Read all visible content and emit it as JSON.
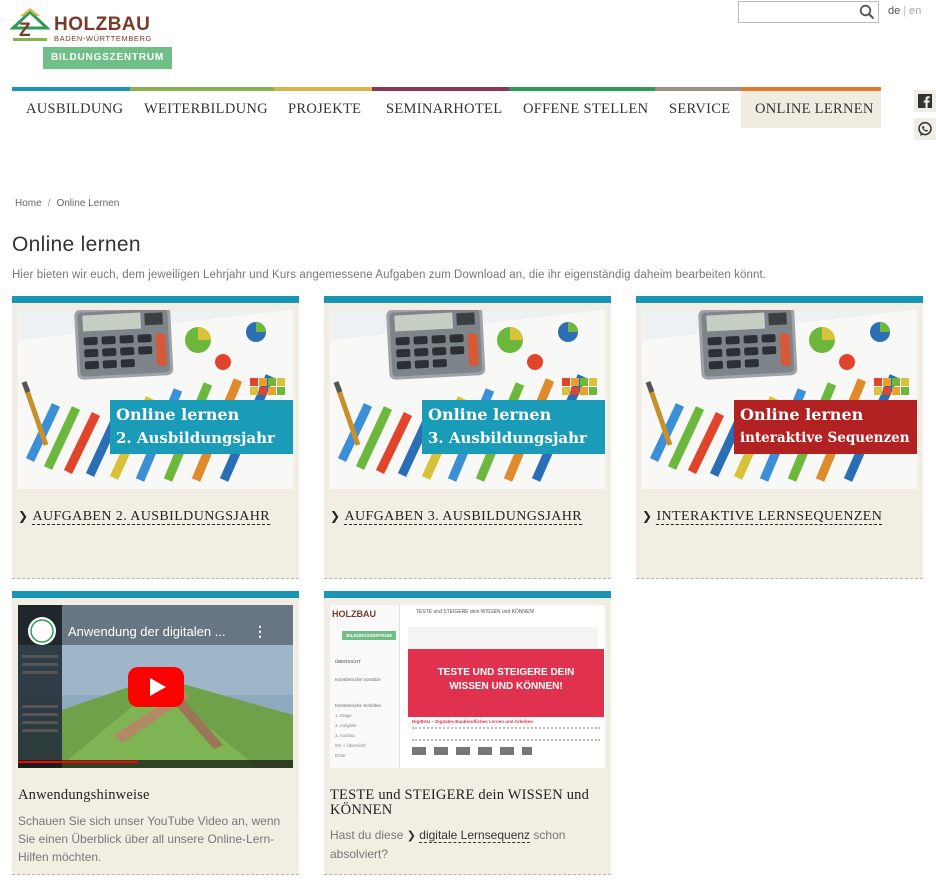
{
  "header": {
    "brand": "HOLZBAU",
    "brand_sub": "BADEN-WÜRTTEMBERG",
    "brand_badge": "BILDUNGSZENTRUM",
    "search_placeholder": "",
    "lang_de": "de",
    "lang_sep": "|",
    "lang_en": "en"
  },
  "nav": {
    "items": [
      {
        "label": "AUSBILDUNG",
        "color": "#1896b4"
      },
      {
        "label": "WEITERBILDUNG",
        "color": "#8bb24a"
      },
      {
        "label": "PROJEKTE",
        "color": "#d9b54a"
      },
      {
        "label": "SEMINARHOTEL",
        "color": "#8e3554"
      },
      {
        "label": "OFFENE STELLEN",
        "color": "#2f9a57"
      },
      {
        "label": "SERVICE",
        "color": "#9b9081"
      },
      {
        "label": "ONLINE LERNEN",
        "color": "#e07b2c"
      }
    ]
  },
  "breadcrumb": {
    "home": "Home",
    "sep": "/",
    "current": "Online Lernen"
  },
  "page": {
    "title": "Online lernen",
    "intro": "Hier bieten wir euch, dem jeweiligen Lehrjahr und Kurs angemessene Aufgaben zum Download an, die ihr eigenständig daheim bearbeiten könnt."
  },
  "cards": [
    {
      "overlay_line1": "Online lernen",
      "overlay_line2": "2. Ausbildungsjahr",
      "overlay_color": "#1a9bb8",
      "link": "AUFGABEN 2. AUSBILDUNGSJAHR"
    },
    {
      "overlay_line1": "Online lernen",
      "overlay_line2": "3. Ausbildungsjahr",
      "overlay_color": "#1a9bb8",
      "link": "AUFGABEN 3. AUSBILDUNGSJAHR"
    },
    {
      "overlay_line1": "Online lernen",
      "overlay_line2": "interaktive Sequenzen",
      "overlay_color": "#b22222",
      "link": "INTERAKTIVE LERNSEQUENZEN"
    },
    {
      "video_title": "Anwendung der digitalen ...",
      "title": "Anwendungshinweise",
      "text": "Schauen Sie sich unser YouTube Video an, wenn Sie einen Überblick über all unsere Online-Lern-Hilfen möchten."
    },
    {
      "title": "TESTE und STEIGERE dein WISSEN und KÖNNEN",
      "text_before": "Hast du diese",
      "link": "digitale Lernsequenz",
      "text_after": "schon absolviert?",
      "thumb_brand": "HOLZBAU",
      "thumb_badge": "BILDUNGSZENTRUM",
      "thumb_heading": "TESTE und STEIGERE dein WISSEN und KÖNNEN!",
      "thumb_banner_line1": "TESTE UND STEIGERE DEIN",
      "thumb_banner_line2": "WISSEN UND KÖNNEN!",
      "thumb_caption": "DigiBAU – Digitales Bauberufliches Lernen und Arbeiten",
      "thumb_sidebar": [
        "ÜBERSICHT",
        "Künstlerische Vorsätze",
        "Künstlerische Schriften",
        "1. Etage",
        "2. Aufgabe",
        "3. Ausbau",
        "OK + Übersicht",
        "Ende"
      ]
    }
  ],
  "colors": {
    "card_bg": "#f2eee4",
    "card_top": "#1896b4",
    "logo_green": "#6fbf86",
    "logo_brown": "#7a3a2a",
    "youtube_red": "#ff0000",
    "banner_red": "#e0324e"
  },
  "icons": [
    "search-icon",
    "facebook-icon",
    "whatsapp-icon",
    "chevron-right-icon",
    "youtube-play-icon",
    "calculator-chart-image"
  ]
}
